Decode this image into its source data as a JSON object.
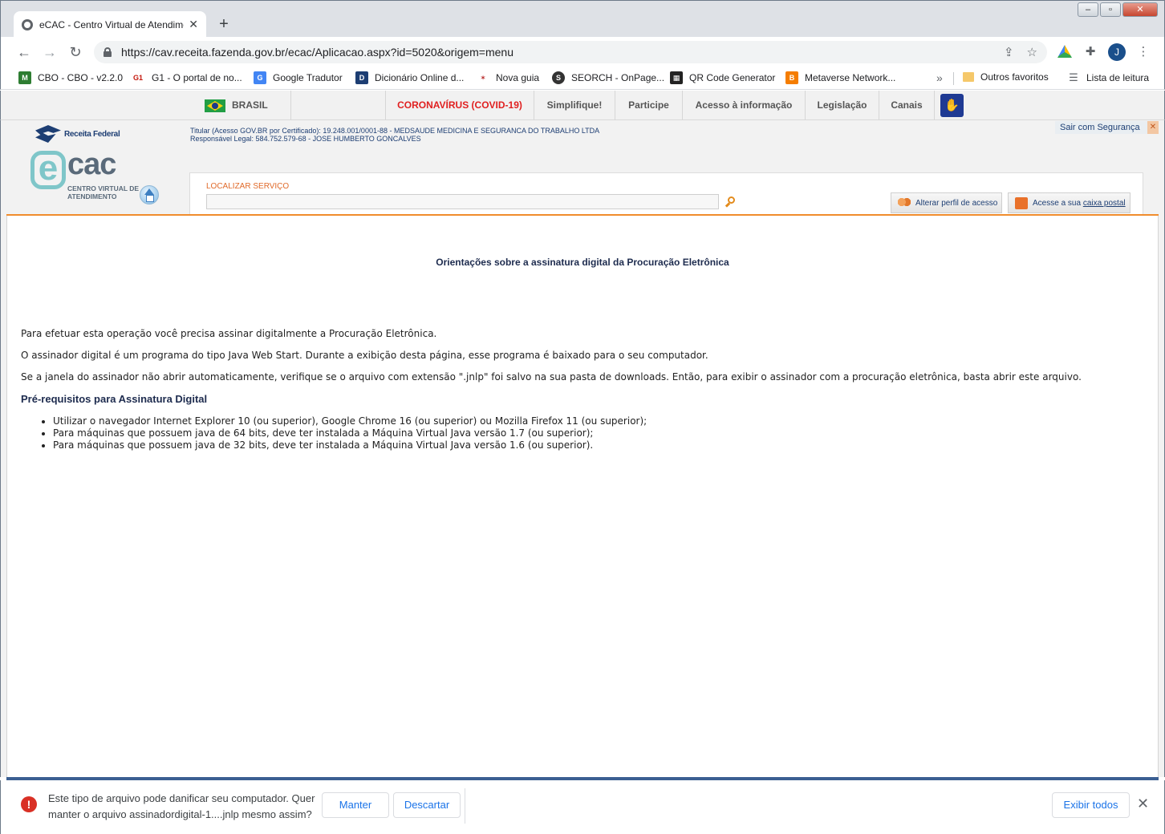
{
  "browser": {
    "tab_title": "eCAC - Centro Virtual de Atendimento",
    "url": "https://cav.receita.fazenda.gov.br/ecac/Aplicacao.aspx?id=5020&origem=menu",
    "avatar_letter": "J",
    "bookmarks": [
      {
        "label": "CBO - CBO - v2.2.0",
        "icon": "mte-icon"
      },
      {
        "label": "G1 - O portal de no...",
        "icon": "g1-icon"
      },
      {
        "label": "Google Tradutor",
        "icon": "translate-icon"
      },
      {
        "label": "Dicionário Online d...",
        "icon": "dictionary-icon"
      },
      {
        "label": "Nova guia",
        "icon": "star-icon"
      },
      {
        "label": "SEORCH - OnPage...",
        "icon": "seo-icon"
      },
      {
        "label": "QR Code Generator",
        "icon": "qr-icon"
      },
      {
        "label": "Metaverse Network...",
        "icon": "blogger-icon"
      }
    ],
    "other_favorites": "Outros favoritos",
    "reading_list": "Lista de leitura"
  },
  "govbar": {
    "country": "BRASIL",
    "items": [
      "CORONAVÍRUS (COVID-19)",
      "Simplifique!",
      "Participe",
      "Acesso à informação",
      "Legislação",
      "Canais"
    ]
  },
  "ecac": {
    "agency": "Receita Federal",
    "logo_e": "e",
    "logo_cac": "cac",
    "logo_sub": "CENTRO VIRTUAL DE ATENDIMENTO",
    "titular": "Titular (Acesso GOV.BR por Certificado): 19.248.001/0001-88 - MEDSAUDE MEDICINA E SEGURANCA DO TRABALHO LTDA",
    "responsavel": "Responsável Legal: 584.752.579-68 - JOSE HUMBERTO GONCALVES",
    "logout": "Sair com Segurança",
    "search_label": "LOCALIZAR SERVIÇO",
    "search_value": "",
    "profile_button": "Alterar perfil de acesso",
    "mailbox_prefix": "Acesse a sua ",
    "mailbox_link": "caixa postal"
  },
  "content": {
    "title": "Orientações sobre a assinatura digital da Procuração Eletrônica",
    "paragraphs": [
      "Para efetuar esta operação você precisa assinar digitalmente a Procuração Eletrônica.",
      "O assinador digital é um programa do tipo Java Web Start. Durante a exibição desta página, esse programa é baixado para o seu computador.",
      "Se a janela do assinador não abrir automaticamente, verifique se o arquivo com extensão \".jnlp\" foi salvo na sua pasta de downloads. Então, para exibir o assinador com a procuração eletrônica, basta abrir este arquivo."
    ],
    "prereq_title": "Pré-requisitos para Assinatura Digital",
    "prereqs": [
      "Utilizar o navegador Internet Explorer 10 (ou superior), Google Chrome 16 (ou superior) ou Mozilla Firefox 11 (ou superior);",
      "Para máquinas que possuem java de 64 bits, deve ter instalada a Máquina Virtual Java versão 1.7 (ou superior);",
      "Para máquinas que possuem java de 32 bits, deve ter instalada a Máquina Virtual Java versão 1.6 (ou superior)."
    ]
  },
  "download": {
    "warning": "Este tipo de arquivo pode danificar seu computador. Quer manter o arquivo assinadordigital-1....jnlp mesmo assim?",
    "keep": "Manter",
    "discard": "Descartar",
    "show_all": "Exibir todos"
  }
}
